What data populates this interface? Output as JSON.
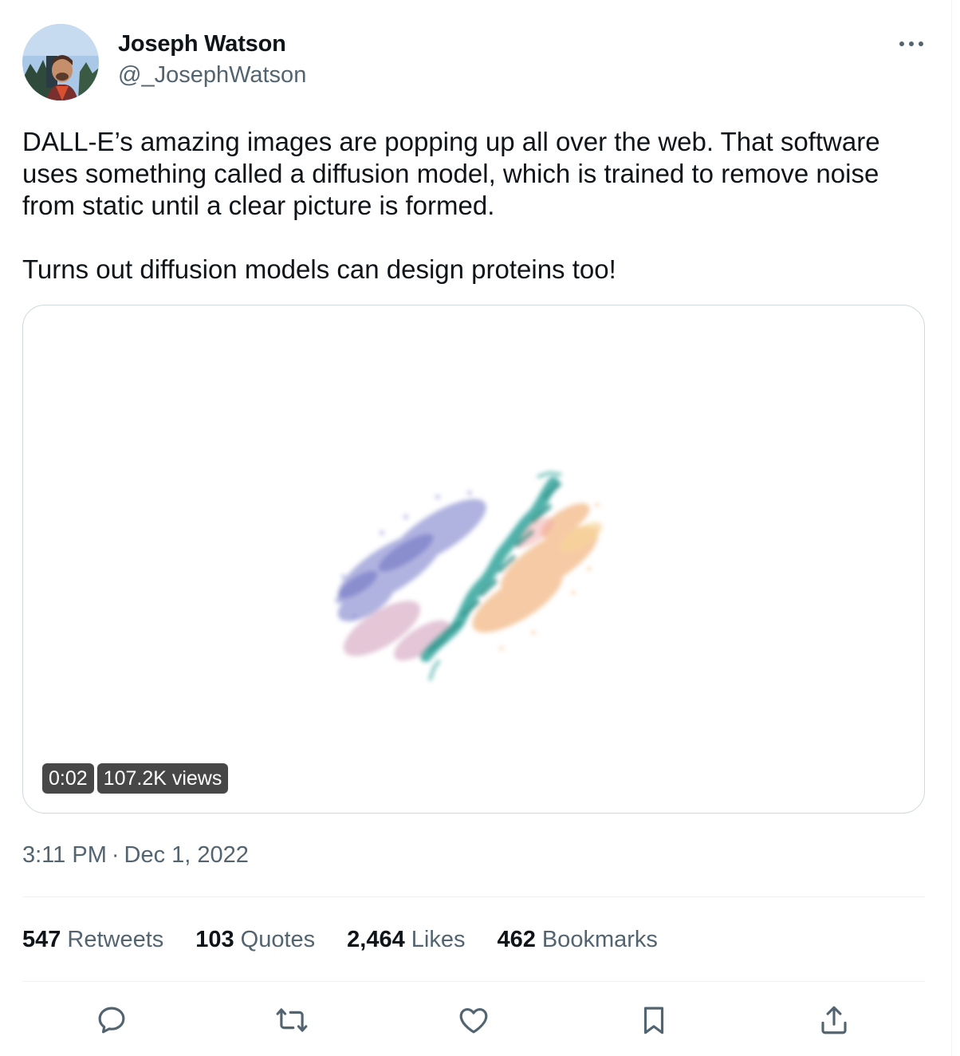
{
  "author": {
    "display_name": "Joseph Watson",
    "handle": "@_JosephWatson"
  },
  "tweet": {
    "paragraph1": "DALL-E’s amazing images are popping up all over the web. That software uses something called a diffusion model, which is trained to remove noise from static until a clear picture is formed.",
    "paragraph2": "Turns out diffusion models can design proteins too!"
  },
  "media": {
    "duration": "0:02",
    "views": "107.2K views"
  },
  "timestamp": {
    "time": "3:11 PM",
    "separator": "·",
    "date": "Dec 1, 2022"
  },
  "stats": {
    "retweets_count": "547",
    "retweets_label": "Retweets",
    "quotes_count": "103",
    "quotes_label": "Quotes",
    "likes_count": "2,464",
    "likes_label": "Likes",
    "bookmarks_count": "462",
    "bookmarks_label": "Bookmarks"
  },
  "icons": {
    "more": "more-horizontal-icon",
    "reply": "reply-icon",
    "retweet": "retweet-icon",
    "like": "heart-icon",
    "bookmark": "bookmark-icon",
    "share": "share-icon"
  },
  "colors": {
    "text_primary": "#0f1419",
    "text_secondary": "#536471",
    "border": "#cfd9de",
    "protein_teal": "#2aa198",
    "protein_purple": "#8b8fd1",
    "protein_orange": "#f0b27a"
  }
}
